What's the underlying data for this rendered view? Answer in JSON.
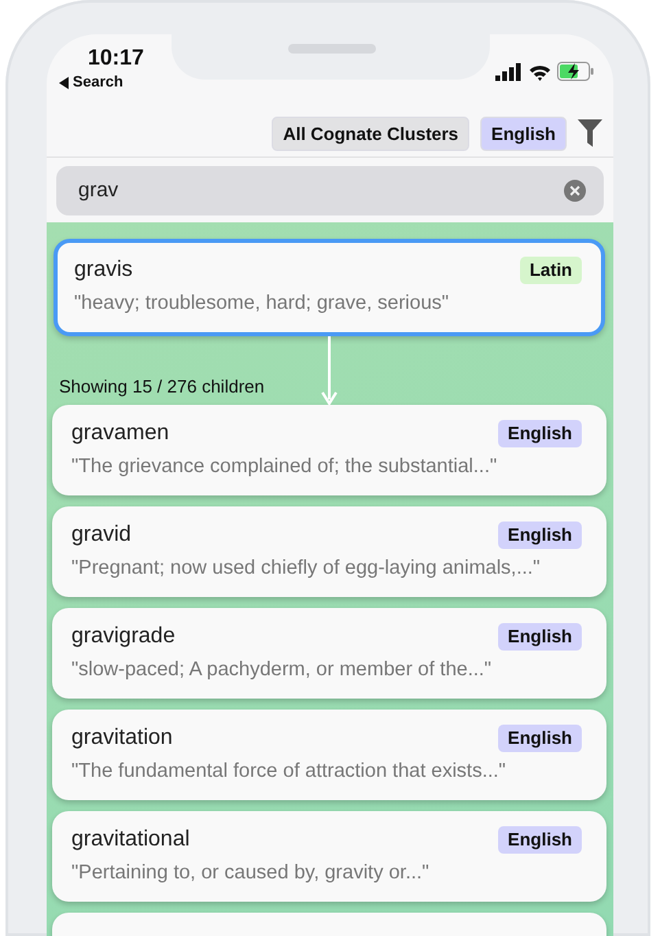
{
  "status_bar": {
    "time": "10:17",
    "back_label": "Search"
  },
  "filters": [
    {
      "label": "All Cognate Clusters",
      "kind": "cluster"
    },
    {
      "label": "English",
      "kind": "language"
    }
  ],
  "search": {
    "value": "grav"
  },
  "parent": {
    "word": "gravis",
    "language": "Latin",
    "color": "#d6f5cc",
    "gloss": "\"heavy; troublesome, hard; grave, serious\"",
    "selected": true
  },
  "showing": "Showing 15 / 276 children",
  "children": [
    {
      "word": "gravamen",
      "language": "English",
      "color": "#d2d2fb",
      "gloss": "\"The grievance complained of; the substantial...\"",
      "selected": false
    },
    {
      "word": "gravid",
      "language": "English",
      "color": "#d2d2fb",
      "gloss": "\"Pregnant; now used chiefly of egg-laying animals,...\"",
      "selected": false
    },
    {
      "word": "gravigrade",
      "language": "English",
      "color": "#d2d2fb",
      "gloss": "\"slow-paced; A pachyderm, or member of the...\"",
      "selected": false
    },
    {
      "word": "gravitation",
      "language": "English",
      "color": "#d2d2fb",
      "gloss": "\"The fundamental force of attraction that exists...\"",
      "selected": false
    },
    {
      "word": "gravitational",
      "language": "English",
      "color": "#d2d2fb",
      "gloss": "\"Pertaining to, or caused by, gravity or...\"",
      "selected": false
    },
    {
      "selected": false
    }
  ]
}
